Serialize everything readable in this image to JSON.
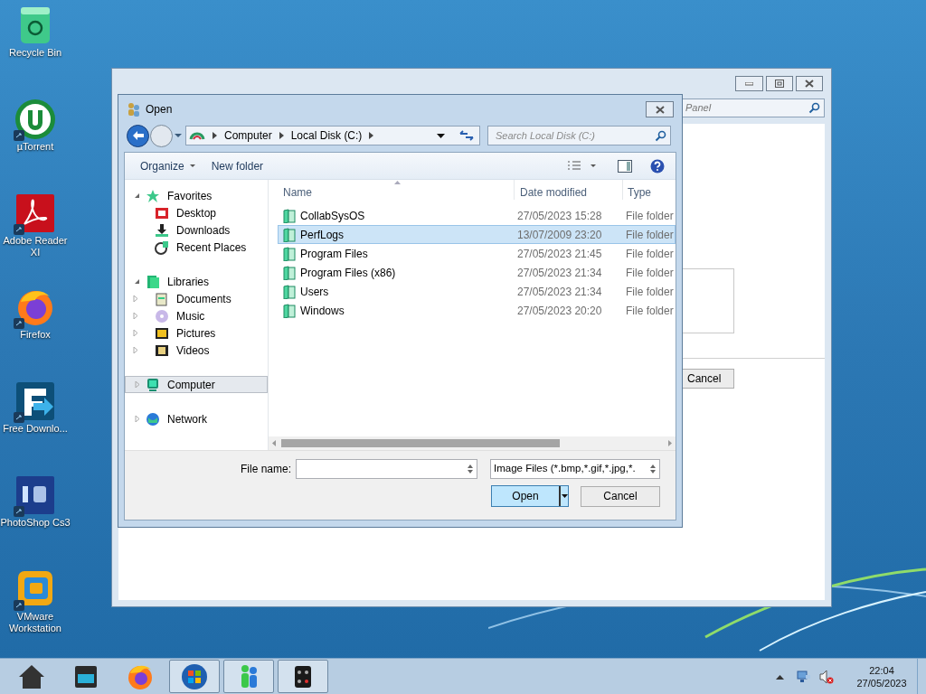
{
  "desktop_icons": [
    {
      "label": "Recycle Bin",
      "kind": "recycle",
      "shortcut": false
    },
    {
      "label": "µTorrent",
      "kind": "torrent",
      "shortcut": true
    },
    {
      "label": "Adobe Reader XI",
      "kind": "pdf",
      "shortcut": true
    },
    {
      "label": "Firefox",
      "kind": "firefox",
      "shortcut": true
    },
    {
      "label": "Free Downlo...",
      "kind": "download",
      "shortcut": true
    },
    {
      "label": "PhotoShop Cs3",
      "kind": "photoshop",
      "shortcut": true
    },
    {
      "label": "VMware Workstation",
      "kind": "vmware",
      "shortcut": true
    }
  ],
  "background_window": {
    "search_text": "Panel",
    "button": "Cancel"
  },
  "dialog": {
    "title": "Open",
    "breadcrumbs": [
      "Computer",
      "Local Disk (C:)"
    ],
    "search_placeholder": "Search Local Disk (C:)",
    "toolbar": [
      {
        "label": "Organize",
        "menu": true
      },
      {
        "label": "New folder",
        "menu": false
      }
    ],
    "nav": [
      {
        "label": "Favorites",
        "kind": "star",
        "expanded": true,
        "selected": false,
        "children": [
          {
            "label": "Desktop",
            "kind": "desktop",
            "selected": false
          },
          {
            "label": "Downloads",
            "kind": "download",
            "selected": false
          },
          {
            "label": "Recent Places",
            "kind": "recent",
            "selected": false
          }
        ]
      },
      {
        "label": "Libraries",
        "kind": "library",
        "expanded": true,
        "selected": false,
        "children": [
          {
            "label": "Documents",
            "kind": "documents",
            "expanded": false,
            "selected": false
          },
          {
            "label": "Music",
            "kind": "music",
            "expanded": false,
            "selected": false
          },
          {
            "label": "Pictures",
            "kind": "pictures",
            "expanded": false,
            "selected": false
          },
          {
            "label": "Videos",
            "kind": "videos",
            "expanded": false,
            "selected": false
          }
        ]
      },
      {
        "label": "Computer",
        "kind": "computer",
        "expanded": false,
        "selected": true
      },
      {
        "label": "Network",
        "kind": "network",
        "expanded": false,
        "selected": false
      }
    ],
    "columns": [
      "Name",
      "Date modified",
      "Type"
    ],
    "rows": [
      {
        "name": "CollabSysOS",
        "date": "27/05/2023 15:28",
        "type": "File folder",
        "selected": false
      },
      {
        "name": "PerfLogs",
        "date": "13/07/2009 23:20",
        "type": "File folder",
        "selected": true
      },
      {
        "name": "Program Files",
        "date": "27/05/2023 21:45",
        "type": "File folder",
        "selected": false
      },
      {
        "name": "Program Files (x86)",
        "date": "27/05/2023 21:34",
        "type": "File folder",
        "selected": false
      },
      {
        "name": "Users",
        "date": "27/05/2023 21:34",
        "type": "File folder",
        "selected": false
      },
      {
        "name": "Windows",
        "date": "27/05/2023 20:20",
        "type": "File folder",
        "selected": false
      }
    ],
    "file_name_label": "File name:",
    "file_type": "Image Files (*.bmp,*.gif,*.jpg,*.",
    "open_button": "Open",
    "cancel_button": "Cancel"
  },
  "taskbar": {
    "apps": [
      {
        "kind": "home",
        "active": false
      },
      {
        "kind": "files",
        "active": false
      },
      {
        "kind": "firefox",
        "active": false
      },
      {
        "kind": "start",
        "active": true
      },
      {
        "kind": "messenger",
        "active": true
      },
      {
        "kind": "calculator",
        "active": true
      }
    ],
    "time": "22:04",
    "date": "27/05/2023"
  }
}
